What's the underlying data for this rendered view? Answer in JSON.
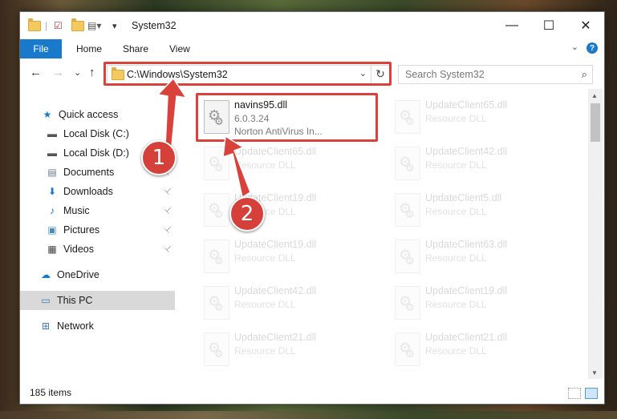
{
  "window": {
    "title": "System32",
    "controls": {
      "minimize": "—",
      "maximize": "☐",
      "close": "✕"
    }
  },
  "ribbon": {
    "tabs": [
      "File",
      "Home",
      "Share",
      "View"
    ],
    "help": "?",
    "collapse": "⌄"
  },
  "nav": {
    "back": "←",
    "forward": "→",
    "recent": "⌄",
    "up": "↑",
    "address": "C:\\Windows\\System32",
    "address_dropdown": "⌄",
    "refresh": "↻",
    "search_placeholder": "Search System32",
    "search_icon": "⌕"
  },
  "sidebar": {
    "items": [
      {
        "label": "Quick access",
        "icon": "star-icon",
        "glyph": "★",
        "color": "#1979ca"
      },
      {
        "label": "Local Disk (C:)",
        "icon": "drive-icon",
        "glyph": "▬",
        "color": "#555555"
      },
      {
        "label": "Local Disk (D:)",
        "icon": "drive-icon",
        "glyph": "▬",
        "color": "#555555"
      },
      {
        "label": "Documents",
        "icon": "documents-icon",
        "glyph": "▤",
        "color": "#6a7a8a"
      },
      {
        "label": "Downloads",
        "icon": "download-icon",
        "glyph": "⬇",
        "color": "#1979ca"
      },
      {
        "label": "Music",
        "icon": "music-icon",
        "glyph": "♪",
        "color": "#1979ca"
      },
      {
        "label": "Pictures",
        "icon": "pictures-icon",
        "glyph": "▣",
        "color": "#4a8ac0"
      },
      {
        "label": "Videos",
        "icon": "videos-icon",
        "glyph": "▦",
        "color": "#444444"
      },
      {
        "label": "OneDrive",
        "icon": "cloud-icon",
        "glyph": "☁",
        "color": "#1979ca"
      },
      {
        "label": "This PC",
        "icon": "computer-icon",
        "glyph": "▭",
        "color": "#3a7ab0"
      },
      {
        "label": "Network",
        "icon": "network-icon",
        "glyph": "⊞",
        "color": "#3a7ab0"
      }
    ],
    "pin_glyph": "📌"
  },
  "files": {
    "main": {
      "name": "navins95.dll",
      "version": "6.0.3.24",
      "company": "Norton AntiVirus In..."
    },
    "faded": [
      {
        "name": "UpdateClient65.dll",
        "desc": "Resource DLL"
      },
      {
        "name": "UpdateClient65.dll",
        "desc": "Resource DLL"
      },
      {
        "name": "UpdateClient42.dll",
        "desc": "Resource DLL"
      },
      {
        "name": "UpdateClient19.dll",
        "desc": "Resource DLL"
      },
      {
        "name": "UpdateClient5.dll",
        "desc": "Resource DLL"
      },
      {
        "name": "UpdateClient19.dll",
        "desc": "Resource DLL"
      },
      {
        "name": "UpdateClient63.dll",
        "desc": "Resource DLL"
      },
      {
        "name": "UpdateClient42.dll",
        "desc": "Resource DLL"
      },
      {
        "name": "UpdateClient19.dll",
        "desc": "Resource DLL"
      },
      {
        "name": "UpdateClient21.dll",
        "desc": "Resource DLL"
      },
      {
        "name": "UpdateClient21.dll",
        "desc": "Resource DLL"
      }
    ]
  },
  "status": {
    "item_count": "185 items"
  },
  "annotations": {
    "badge1": "1",
    "badge2": "2",
    "color": "#d9413a"
  }
}
